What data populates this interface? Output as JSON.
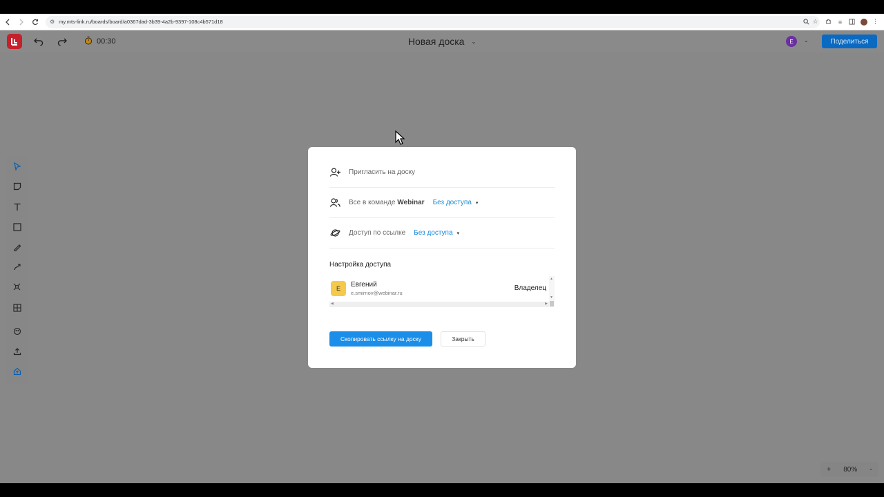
{
  "browser": {
    "url": "my.mts-link.ru/boards/board/a0367dad-3b39-4a2b-9397-108c4b571d18"
  },
  "header": {
    "timer": "00:30",
    "board_title": "Новая доска",
    "user_initial": "E",
    "share_label": "Поделиться"
  },
  "modal": {
    "invite_placeholder": "Пригласить на доску",
    "team_prefix": "Все в команде",
    "team_name": "Webinar",
    "team_access": "Без доступа",
    "link_label": "Доступ по ссылке",
    "link_access": "Без доступа",
    "section_title": "Настройка доступа",
    "member": {
      "initial": "E",
      "name": "Евгений",
      "email": "e.smirnov@webinar.ru",
      "role": "Владелец"
    },
    "copy_label": "Скопировать ссылку на доску",
    "close_label": "Закрыть"
  },
  "zoom": {
    "plus": "+",
    "level": "80%",
    "minus": "-"
  },
  "colors": {
    "brand": "#c5202b",
    "accent": "#1a8ee8",
    "link": "#1a8ad8",
    "overlay": "#888888",
    "avatar_member": "#f5c94a",
    "avatar_user": "#6b2fa0"
  }
}
